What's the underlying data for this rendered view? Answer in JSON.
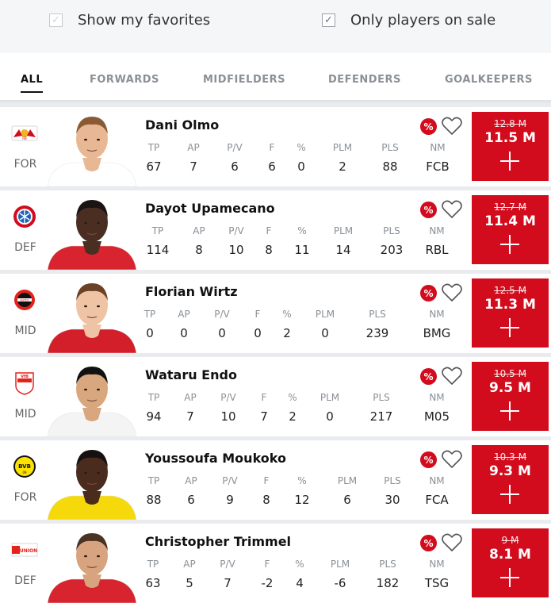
{
  "filters": {
    "favorites": {
      "label": "Show my favorites",
      "checked": false
    },
    "on_sale": {
      "label": "Only players on sale",
      "checked": true
    }
  },
  "tabs": [
    {
      "label": "ALL",
      "active": true
    },
    {
      "label": "FORWARDS",
      "active": false
    },
    {
      "label": "MIDFIELDERS",
      "active": false
    },
    {
      "label": "DEFENDERS",
      "active": false
    },
    {
      "label": "GOALKEEPERS",
      "active": false
    }
  ],
  "stat_headers": [
    "TP",
    "AP",
    "P/V",
    "F",
    "%",
    "PLM",
    "PLS",
    "NM"
  ],
  "sale_badge": "%",
  "players": [
    {
      "name": "Dani Olmo",
      "position": "FOR",
      "club_icon": "rb-leipzig-crest",
      "stats": [
        "67",
        "7",
        "6",
        "6",
        "0",
        "2",
        "88",
        "FCB"
      ],
      "old_price": "12.8 M",
      "price": "11.5 M",
      "kit": "#ffffff",
      "skin": "#e8b894",
      "hair": "#8a5a34"
    },
    {
      "name": "Dayot Upamecano",
      "position": "DEF",
      "club_icon": "bayern-crest",
      "stats": [
        "114",
        "8",
        "10",
        "8",
        "11",
        "14",
        "203",
        "RBL"
      ],
      "old_price": "12.7 M",
      "price": "11.4 M",
      "kit": "#d8242f",
      "skin": "#4a2e22",
      "hair": "#1a1412"
    },
    {
      "name": "Florian Wirtz",
      "position": "MID",
      "club_icon": "leverkusen-crest",
      "stats": [
        "0",
        "0",
        "0",
        "0",
        "2",
        "0",
        "239",
        "BMG"
      ],
      "old_price": "12.5 M",
      "price": "11.3 M",
      "kit": "#d21f2a",
      "skin": "#efc4a4",
      "hair": "#6b4226"
    },
    {
      "name": "Wataru Endo",
      "position": "MID",
      "club_icon": "stuttgart-crest",
      "stats": [
        "94",
        "7",
        "10",
        "7",
        "2",
        "0",
        "217",
        "M05"
      ],
      "old_price": "10.5 M",
      "price": "9.5 M",
      "kit": "#f4f4f4",
      "skin": "#d9a77e",
      "hair": "#111111"
    },
    {
      "name": "Youssoufa Moukoko",
      "position": "FOR",
      "club_icon": "dortmund-crest",
      "stats": [
        "88",
        "6",
        "9",
        "8",
        "12",
        "6",
        "30",
        "FCA"
      ],
      "old_price": "10.3 M",
      "price": "9.3 M",
      "kit": "#f6d90b",
      "skin": "#4a2c1f",
      "hair": "#161110"
    },
    {
      "name": "Christopher Trimmel",
      "position": "DEF",
      "club_icon": "union-berlin-crest",
      "stats": [
        "63",
        "5",
        "7",
        "-2",
        "4",
        "-6",
        "182",
        "TSG"
      ],
      "old_price": "9 M",
      "price": "8.1 M",
      "kit": "#d8242f",
      "skin": "#d7a47f",
      "hair": "#4a3322"
    }
  ]
}
